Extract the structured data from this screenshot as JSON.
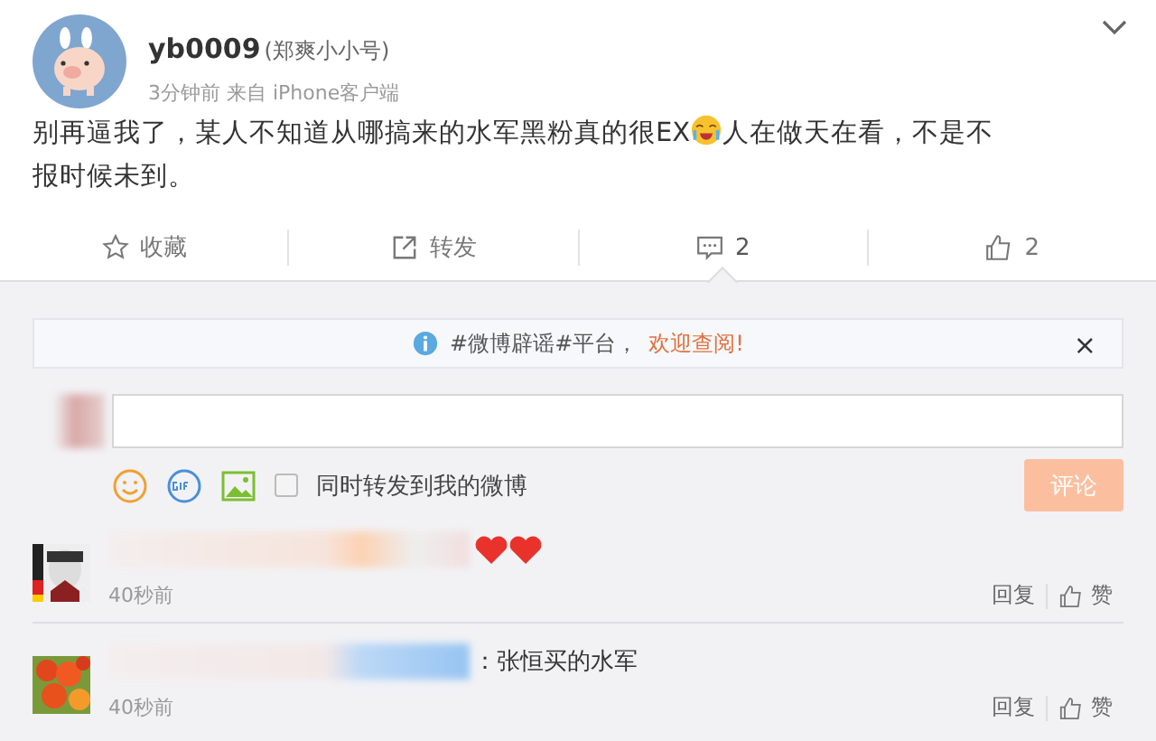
{
  "post": {
    "author": "yb0009",
    "author_note": "(郑爽小小号)",
    "meta": "3分钟前 来自 iPhone客户端",
    "content": [
      "别再逼我了，某人不知道从哪搞来的水军黑粉真的很EX",
      "人在做天在看，不是不",
      "报时候未到。"
    ]
  },
  "actions": [
    {
      "kind": "favorite",
      "label": "收藏",
      "selected": false
    },
    {
      "kind": "repost",
      "label": "转发",
      "selected": false
    },
    {
      "kind": "comment",
      "label": "2",
      "selected": true
    },
    {
      "kind": "like",
      "label": "2",
      "selected": false
    }
  ],
  "notice": {
    "text": "#微博辟谣#平台，",
    "link": "欢迎查阅!",
    "close": "×"
  },
  "composer": {
    "repost_label": "同时转发到我的微博",
    "repost_checked": false,
    "submit": "评论",
    "submit_disabled": true
  },
  "comments": [
    {
      "hearts": true,
      "time": "40秒前",
      "reply": "回复",
      "like": "赞"
    },
    {
      "text": "：张恒买的水军",
      "hearts": false,
      "time": "40秒前",
      "reply": "回复",
      "like": "赞"
    }
  ]
}
